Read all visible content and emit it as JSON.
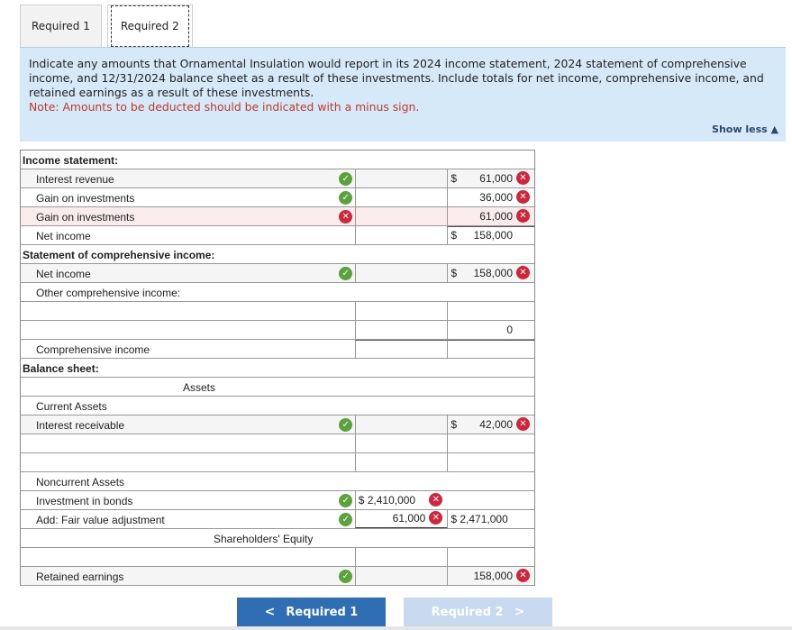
{
  "tabs": [
    {
      "label": "Required 1"
    },
    {
      "label": "Required 2"
    }
  ],
  "instructions": {
    "text": "Indicate any amounts that Ornamental Insulation would report in its 2024 income statement, 2024 statement of comprehensive income, and 12/31/2024 balance sheet as a result of these investments. Include totals for net income, comprehensive income, and retained earnings as a result of these investments.",
    "note": "Note: Amounts to be deducted should be indicated with a minus sign."
  },
  "show_less": "Show less",
  "sheet": {
    "income_statement": "Income statement:",
    "interest_revenue": {
      "label": "Interest revenue",
      "dollar": "$",
      "value": "61,000"
    },
    "gain_on_investments_1": {
      "label": "Gain on investments",
      "value": "36,000"
    },
    "gain_on_investments_2": {
      "label": "Gain on investments",
      "value": "61,000"
    },
    "net_income": {
      "label": "Net income",
      "dollar": "$",
      "value": "158,000"
    },
    "soci": "Statement of comprehensive income:",
    "soci_net_income": {
      "label": "Net income",
      "dollar": "$",
      "value": "158,000"
    },
    "oci": "Other comprehensive income:",
    "oci_total": "0",
    "comprehensive_income": "Comprehensive income",
    "balance_sheet": "Balance sheet:",
    "assets": "Assets",
    "current_assets": "Current Assets",
    "interest_receivable": {
      "label": "Interest receivable",
      "dollar": "$",
      "value": "42,000"
    },
    "noncurrent_assets": "Noncurrent Assets",
    "investment_in_bonds": {
      "label": "Investment in bonds",
      "value": "$ 2,410,000"
    },
    "fair_value_adj": {
      "label": "Add: Fair value adjustment",
      "value": "61,000",
      "total": "$ 2,471,000"
    },
    "shareholders_equity": "Shareholders' Equity",
    "retained_earnings": {
      "label": "Retained earnings",
      "value": "158,000"
    }
  },
  "buttons": {
    "prev": "Required 1",
    "next": "Required 2"
  },
  "colors": {
    "ok": "#5aa33b",
    "bad": "#d0263c",
    "accent": "#2f6eb5",
    "note": "#c0392b"
  }
}
